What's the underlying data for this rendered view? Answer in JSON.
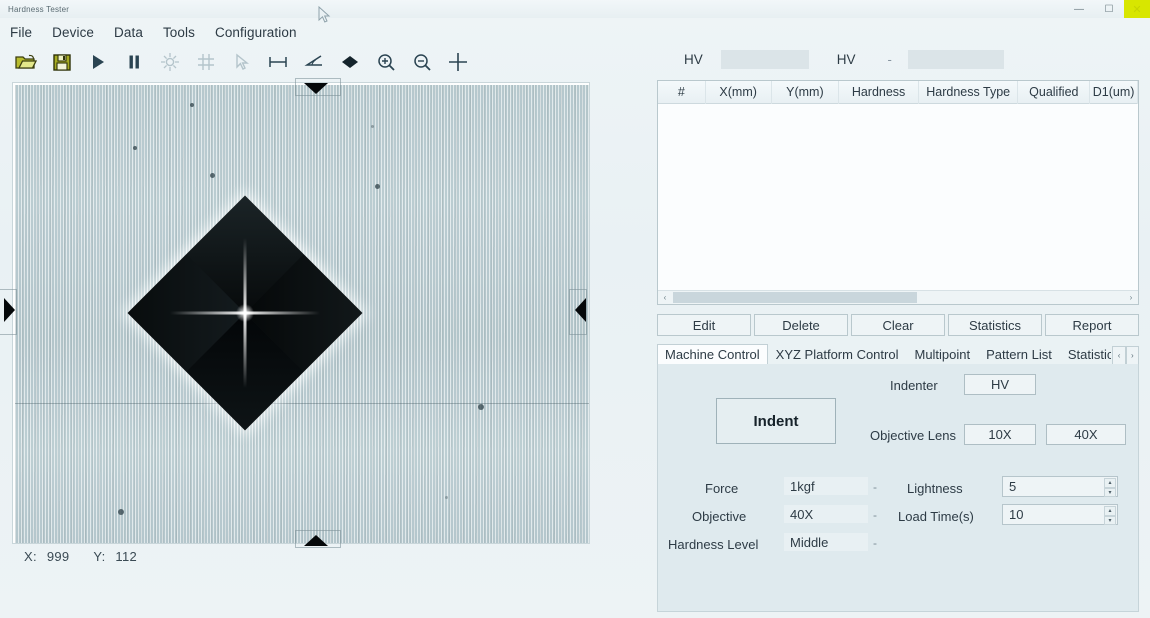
{
  "window": {
    "app_title": "Hardness Tester",
    "minimize": "minimize-icon",
    "maximize": "maximize-icon",
    "close": "close-icon",
    "close_highlight_color": "#d8e600"
  },
  "menubar": {
    "items": [
      {
        "label": "File"
      },
      {
        "label": "Device"
      },
      {
        "label": "Data"
      },
      {
        "label": "Tools"
      },
      {
        "label": "Configuration"
      }
    ]
  },
  "toolbar": {
    "items": [
      {
        "name": "open-folder-icon",
        "title": "Open",
        "enabled": true
      },
      {
        "name": "save-disk-icon",
        "title": "Save",
        "enabled": true
      },
      {
        "name": "play-icon",
        "title": "Run",
        "enabled": true
      },
      {
        "name": "pause-icon",
        "title": "Pause",
        "enabled": true
      },
      {
        "name": "focus-target-icon",
        "title": "Focus",
        "enabled": false
      },
      {
        "name": "grid-icon",
        "title": "Grid",
        "enabled": false
      },
      {
        "name": "pointer-arrow-icon",
        "title": "Select",
        "enabled": false
      },
      {
        "name": "measure-length-icon",
        "title": "Measure Length",
        "enabled": true
      },
      {
        "name": "measure-angle-icon",
        "title": "Measure Angle",
        "enabled": true
      },
      {
        "name": "diamond-indent-icon",
        "title": "Indent Marker",
        "enabled": true
      },
      {
        "name": "zoom-in-icon",
        "title": "Zoom In",
        "enabled": true
      },
      {
        "name": "zoom-out-icon",
        "title": "Zoom Out",
        "enabled": true
      },
      {
        "name": "crosshair-icon",
        "title": "Crosshair",
        "enabled": true
      }
    ]
  },
  "viewer": {
    "name": "microscope-live-image",
    "specimen": "vickers-indentation-diamond",
    "markers": [
      {
        "name": "top-measure-marker",
        "direction": "down"
      },
      {
        "name": "bottom-measure-marker",
        "direction": "up"
      },
      {
        "name": "left-measure-marker",
        "direction": "right"
      },
      {
        "name": "right-measure-marker",
        "direction": "left"
      }
    ],
    "coords": {
      "x_label": "X:",
      "x_value": "999",
      "y_label": "Y:",
      "y_value": "112"
    }
  },
  "hv_header": {
    "label_1": "HV",
    "value_1": "",
    "label_2": "HV",
    "separator": "-",
    "value_2": ""
  },
  "results_table": {
    "columns": [
      "#",
      "X(mm)",
      "Y(mm)",
      "Hardness",
      "Hardness Type",
      "Qualified",
      "D1(um)"
    ],
    "rows": [],
    "scroll_left_arrow": "‹",
    "scroll_right_arrow": "›"
  },
  "action_buttons": [
    {
      "label": "Edit"
    },
    {
      "label": "Delete"
    },
    {
      "label": "Clear"
    },
    {
      "label": "Statistics"
    },
    {
      "label": "Report"
    }
  ],
  "tabs": {
    "items": [
      {
        "label": "Machine Control",
        "active": true
      },
      {
        "label": "XYZ Platform Control",
        "active": false
      },
      {
        "label": "Multipoint",
        "active": false
      },
      {
        "label": "Pattern List",
        "active": false
      },
      {
        "label": "Statistic",
        "active": false
      }
    ],
    "nav_prev": "‹",
    "nav_next": "›"
  },
  "machine_control": {
    "indent_button": "Indent",
    "indenter_label": "Indenter",
    "indenter_value": "HV",
    "objective_lens_label": "Objective Lens",
    "objective_lens_10x": "10X",
    "objective_lens_40x": "40X",
    "fields_left": [
      {
        "label": "Force",
        "value": "1kgf",
        "dropdown": "-"
      },
      {
        "label": "Objective",
        "value": "40X",
        "dropdown": "-"
      },
      {
        "label": "Hardness Level",
        "value": "Middle",
        "dropdown": "-"
      }
    ],
    "fields_right": [
      {
        "label": "Lightness",
        "value": "5",
        "spinner_up": "▴",
        "spinner_down": "▾"
      },
      {
        "label": "Load Time(s)",
        "value": "10",
        "spinner_up": "▴",
        "spinner_down": "▾"
      }
    ]
  }
}
